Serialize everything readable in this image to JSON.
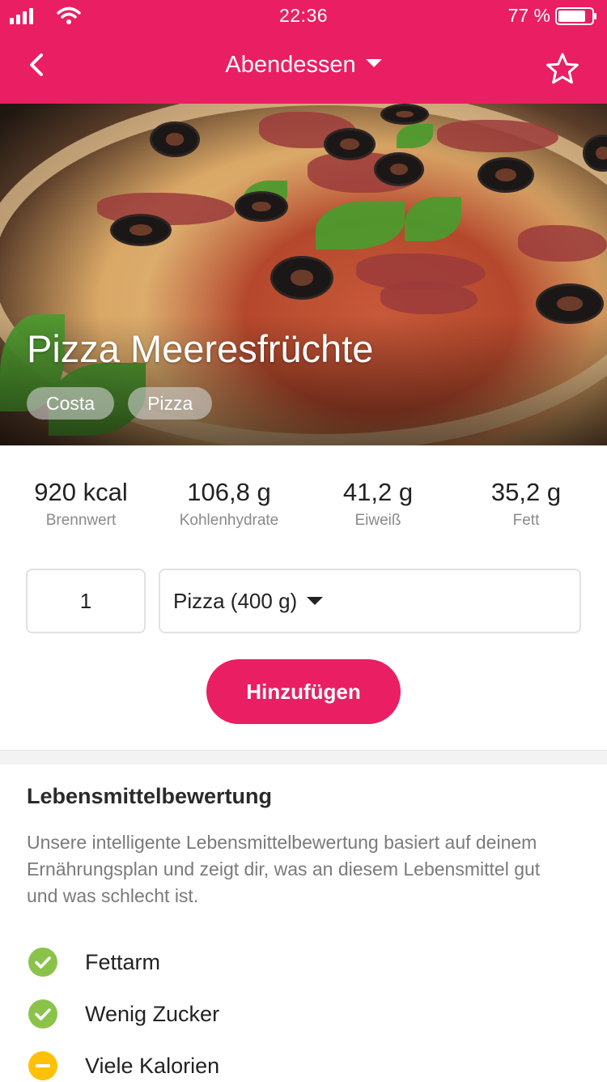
{
  "status_bar": {
    "time": "22:36",
    "battery": "77 %"
  },
  "nav": {
    "title": "Abendessen"
  },
  "hero": {
    "title": "Pizza Meeresfrüchte",
    "tags": [
      "Costa",
      "Pizza"
    ]
  },
  "nutrition": [
    {
      "value": "920 kcal",
      "label": "Brennwert"
    },
    {
      "value": "106,8 g",
      "label": "Kohlenhydrate"
    },
    {
      "value": "41,2 g",
      "label": "Eiweiß"
    },
    {
      "value": "35,2 g",
      "label": "Fett"
    }
  ],
  "portion": {
    "quantity": "1",
    "unit": "Pizza (400 g)"
  },
  "add_button": "Hinzufügen",
  "rating": {
    "title": "Lebensmittelbewertung",
    "description": "Unsere intelligente Lebensmittelbewertung basiert auf deinem Ernährungsplan und zeigt dir, was an diesem Lebensmittel gut und was schlecht ist.",
    "items": [
      {
        "label": "Fettarm",
        "status": "good"
      },
      {
        "label": "Wenig Zucker",
        "status": "good"
      },
      {
        "label": "Viele Kalorien",
        "status": "neutral"
      }
    ]
  },
  "colors": {
    "brand": "#e91e63",
    "good": "#8bc34a",
    "neutral": "#ffc107"
  },
  "icons": {
    "back": "chevron-left-icon",
    "favorite": "star-outline-icon",
    "good": "check-circle-icon",
    "neutral": "minus-circle-icon"
  }
}
